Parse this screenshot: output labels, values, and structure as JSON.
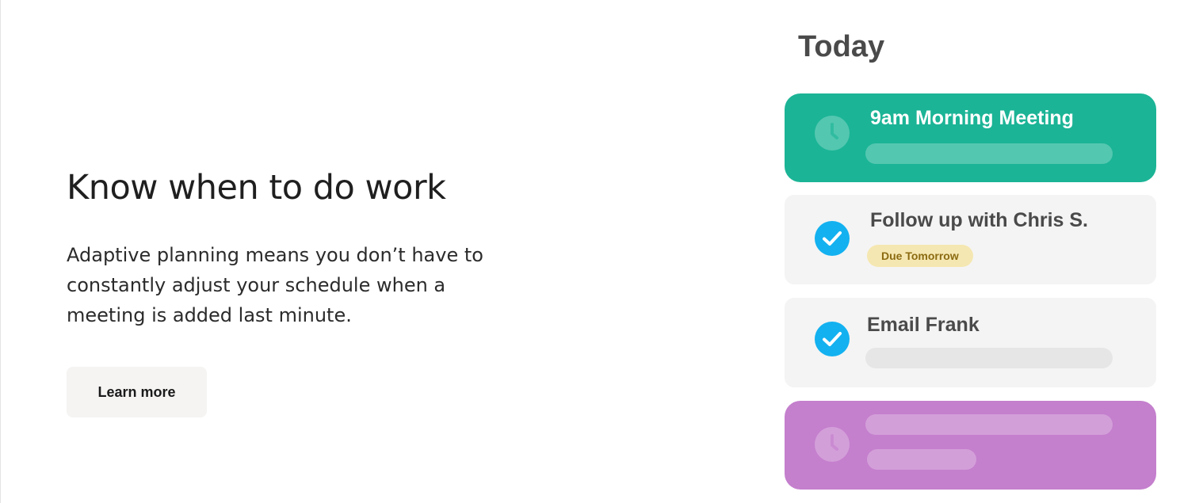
{
  "hero": {
    "heading": "Know when to do work",
    "description": "Adaptive planning means you don’t have to constantly adjust your schedule when a meeting is added last minute.",
    "cta_label": "Learn more"
  },
  "today_panel": {
    "title": "Today",
    "cards": [
      {
        "type": "meeting",
        "icon": "clock-icon",
        "title": "9am Morning Meeting",
        "color": "#1bb496"
      },
      {
        "type": "task",
        "icon": "checkmark-icon",
        "title": "Follow up with Chris S.",
        "badge": "Due Tomorrow",
        "color": "#f4f4f4"
      },
      {
        "type": "task",
        "icon": "checkmark-icon",
        "title": "Email Frank",
        "color": "#f4f4f4"
      },
      {
        "type": "meeting",
        "icon": "clock-icon",
        "title": "",
        "color": "#c47fcd"
      }
    ]
  },
  "colors": {
    "teal": "#1bb496",
    "purple": "#c47fcd",
    "check_blue": "#13b1f0",
    "badge_bg": "#f5e7b1",
    "badge_text": "#8b6b12"
  }
}
